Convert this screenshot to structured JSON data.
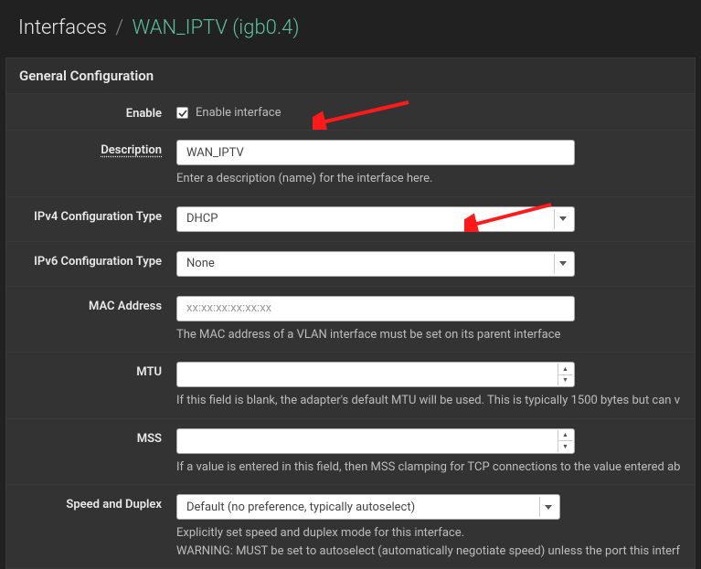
{
  "breadcrumb": {
    "main": "Interfaces",
    "current": "WAN_IPTV (igb0.4)"
  },
  "panel": {
    "title": "General Configuration"
  },
  "fields": {
    "enable": {
      "label": "Enable",
      "checkbox_label": "Enable interface"
    },
    "description": {
      "label": "Description",
      "value": "WAN_IPTV",
      "help": "Enter a description (name) for the interface here."
    },
    "ipv4": {
      "label": "IPv4 Configuration Type",
      "value": "DHCP"
    },
    "ipv6": {
      "label": "IPv6 Configuration Type",
      "value": "None"
    },
    "mac": {
      "label": "MAC Address",
      "placeholder": "xx:xx:xx:xx:xx:xx",
      "help": "The MAC address of a VLAN interface must be set on its parent interface"
    },
    "mtu": {
      "label": "MTU",
      "help": "If this field is blank, the adapter's default MTU will be used. This is typically 1500 bytes but can v"
    },
    "mss": {
      "label": "MSS",
      "help": "If a value is entered in this field, then MSS clamping for TCP connections to the value entered ab"
    },
    "speed": {
      "label": "Speed and Duplex",
      "value": "Default (no preference, typically autoselect)",
      "help1": "Explicitly set speed and duplex mode for this interface.",
      "help2": "WARNING: MUST be set to autoselect (automatically negotiate speed) unless the port this interf"
    }
  }
}
